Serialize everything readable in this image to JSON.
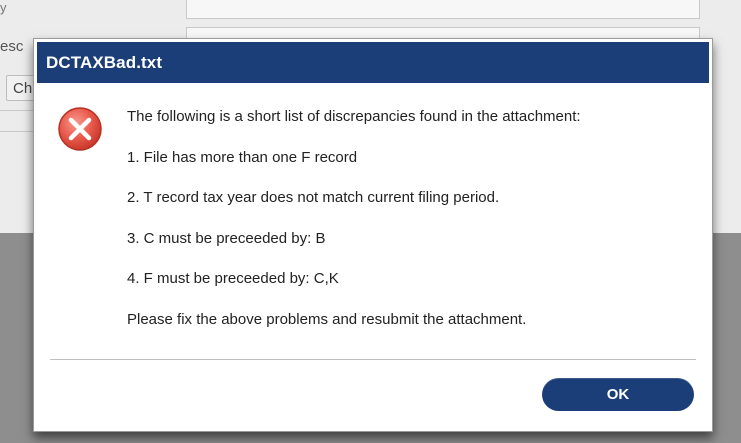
{
  "background": {
    "top_left_mark": "y",
    "field_label": "esc",
    "button_label": "Ch"
  },
  "dialog": {
    "title": "DCTAXBad.txt",
    "icon": "error-x-icon",
    "intro": "The following is a short list of discrepancies found in the attachment:",
    "items": [
      "1. File has more than one F record",
      "2. T record tax year does not match current filing period.",
      "3. C must be preceeded by: B",
      "4. F must be preceeded by: C,K"
    ],
    "closing": "Please fix the above problems and resubmit the attachment.",
    "ok_label": "OK"
  },
  "colors": {
    "titlebar": "#1b3e78",
    "button": "#1b3e78",
    "icon_red": "#e8584a"
  }
}
